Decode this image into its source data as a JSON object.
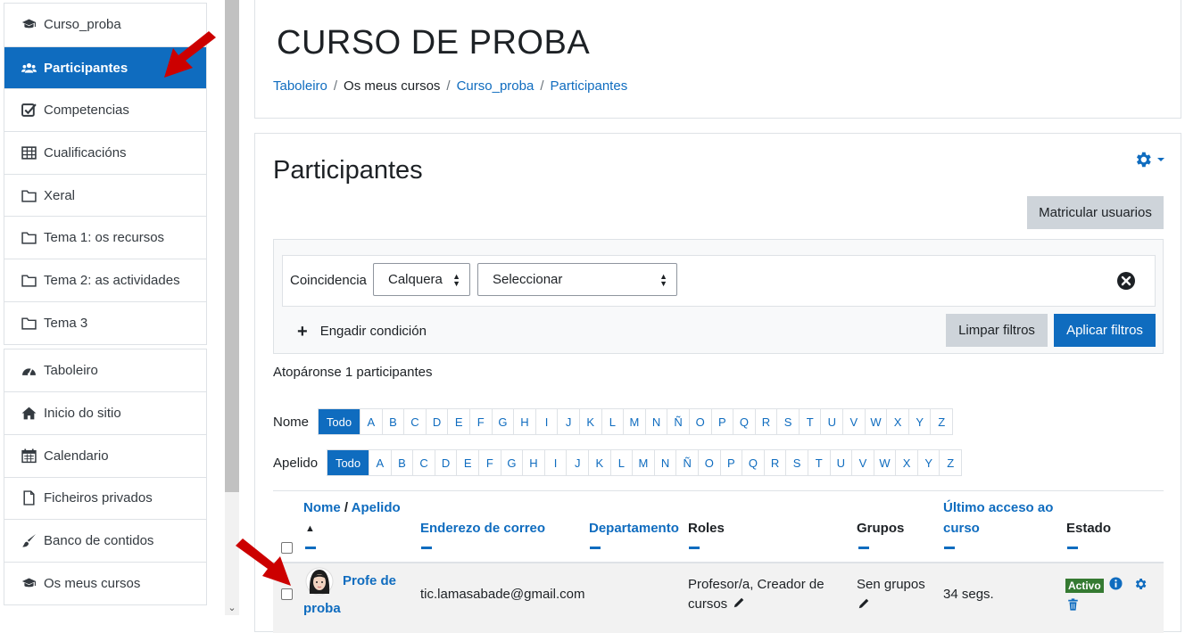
{
  "sidebar": {
    "course_items": [
      {
        "label": "Curso_proba",
        "icon": "graduation-cap-icon"
      },
      {
        "label": "Participantes",
        "icon": "users-icon",
        "active": true
      },
      {
        "label": "Competencias",
        "icon": "checkbox-icon"
      },
      {
        "label": "Cualificacións",
        "icon": "table-icon"
      },
      {
        "label": "Xeral",
        "icon": "folder-icon"
      },
      {
        "label": "Tema 1: os recursos",
        "icon": "folder-icon"
      },
      {
        "label": "Tema 2: as actividades",
        "icon": "folder-icon"
      },
      {
        "label": "Tema 3",
        "icon": "folder-icon"
      }
    ],
    "site_items": [
      {
        "label": "Taboleiro",
        "icon": "dashboard-icon"
      },
      {
        "label": "Inicio do sitio",
        "icon": "home-icon"
      },
      {
        "label": "Calendario",
        "icon": "calendar-icon"
      },
      {
        "label": "Ficheiros privados",
        "icon": "file-icon"
      },
      {
        "label": "Banco de contidos",
        "icon": "paintbrush-icon"
      },
      {
        "label": "Os meus cursos",
        "icon": "graduation-cap-icon"
      }
    ]
  },
  "header": {
    "course_title": "CURSO DE PROBA",
    "breadcrumb": [
      "Taboleiro",
      "Os meus cursos",
      "Curso_proba",
      "Participantes"
    ]
  },
  "main": {
    "heading": "Participantes",
    "enrol_button": "Matricular usuarios",
    "filter": {
      "match_label": "Coincidencia",
      "match_value": "Calquera",
      "type_value": "Seleccionar",
      "add_condition": "Engadir condición",
      "clear_button": "Limpar filtros",
      "apply_button": "Aplicar filtros"
    },
    "count_text": "Atopáronse 1 participantes",
    "initials": {
      "first_label": "Nome",
      "last_label": "Apelido",
      "all": "Todo",
      "letters": [
        "A",
        "B",
        "C",
        "D",
        "E",
        "F",
        "G",
        "H",
        "I",
        "J",
        "K",
        "L",
        "M",
        "N",
        "Ñ",
        "O",
        "P",
        "Q",
        "R",
        "S",
        "T",
        "U",
        "V",
        "W",
        "X",
        "Y",
        "Z"
      ]
    },
    "table": {
      "headers": {
        "name": "Nome",
        "slash": " / ",
        "surname": "Apelido",
        "sort_arrow": "▲",
        "email": "Enderezo de correo",
        "department": "Departamento",
        "roles": "Roles",
        "groups": "Grupos",
        "last_access_1": "Último acceso ao",
        "last_access_2": "curso",
        "status": "Estado"
      },
      "row": {
        "name_1": "Profe de",
        "name_2": "proba",
        "email": "tic.lamasabade@gmail.com",
        "roles_1": "Profesor/a, Creador de",
        "roles_2": "cursos",
        "groups": "Sen grupos",
        "last_access": "34 segs.",
        "status": "Activo"
      }
    }
  },
  "colors": {
    "primary": "#0f6cbf",
    "secondary_button": "#ced4da",
    "active_badge": "#357a32",
    "annotation_arrow": "#cc0000"
  }
}
